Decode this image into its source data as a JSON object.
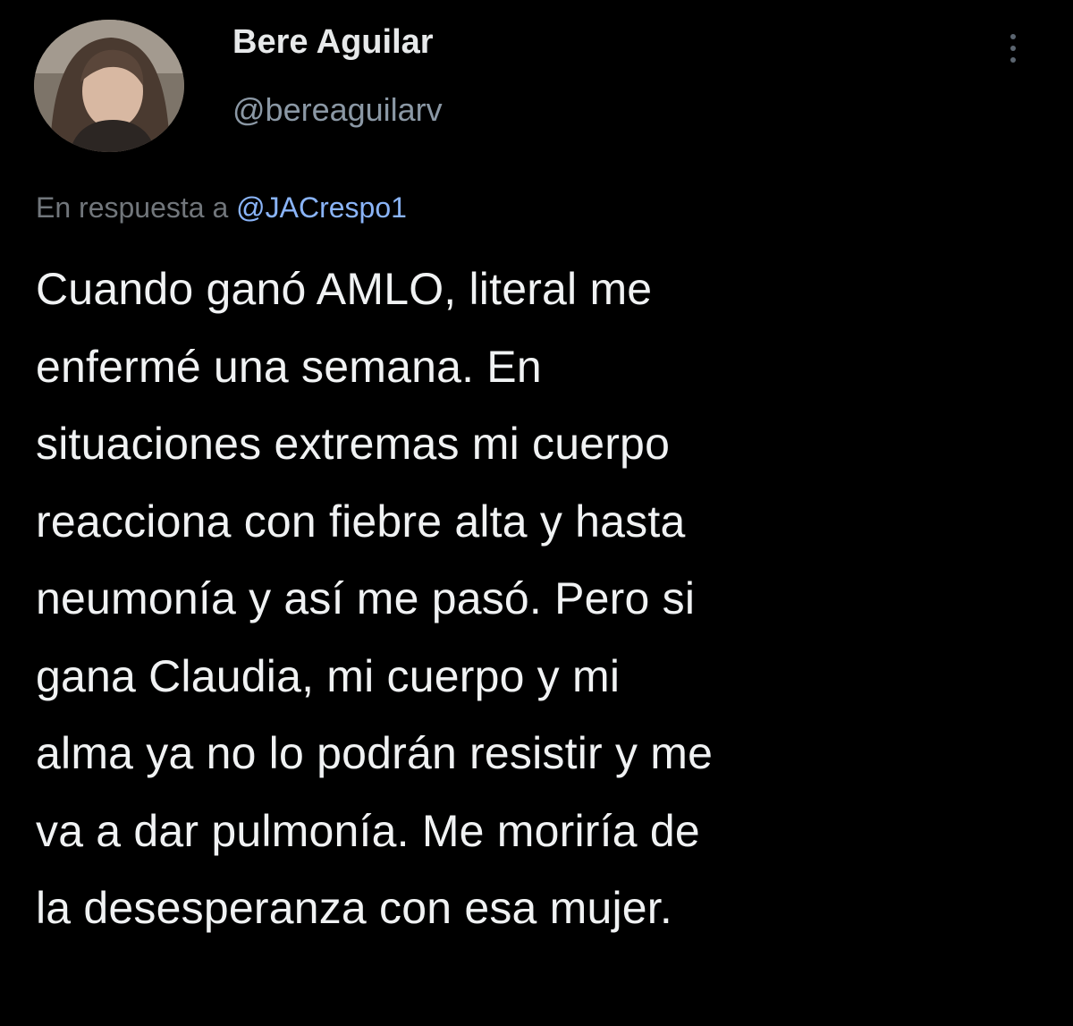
{
  "author": {
    "display_name": "Bere Aguilar",
    "handle": "@bereaguilarv"
  },
  "reply_context": {
    "prefix": "En respuesta a",
    "mention": "@JACrespo1"
  },
  "tweet": {
    "text": "Cuando ganó AMLO, literal me\nenfermé una semana. En\nsituaciones extremas mi cuerpo\nreacciona con fiebre alta y hasta\nneumonía y así me pasó. Pero si\ngana Claudia, mi cuerpo y mi\nalma ya no lo podrán resistir y me\nva a dar pulmonía. Me moriría de\nla desesperanza con esa mujer."
  },
  "icons": {
    "more": "more-vertical-icon"
  },
  "colors": {
    "background": "#000000",
    "primary_text": "#e7e9ea",
    "secondary_text": "#8b98a5",
    "link": "#8ab4f8"
  }
}
